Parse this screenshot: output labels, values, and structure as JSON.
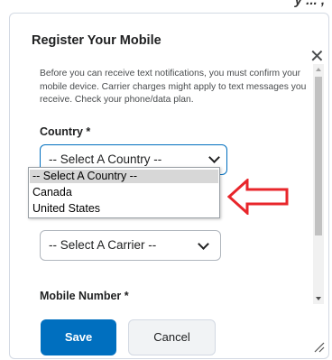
{
  "top_cut_text": "y ... ,",
  "dialog": {
    "title": "Register Your Mobile",
    "close_icon": "close-icon",
    "info_text": "Before you can receive text notifications, you must confirm your mobile device. Carrier charges might apply to text messages you receive. Check your phone/data plan.",
    "country_label": "Country *",
    "country_value": "-- Select A Country --",
    "country_options": [
      "-- Select A Country --",
      "Canada",
      "United States"
    ],
    "country_selected_index": 0,
    "carrier_value": "-- Select A Carrier --",
    "mobile_label": "Mobile Number *",
    "save_label": "Save",
    "cancel_label": "Cancel"
  },
  "annotation": {
    "arrow_color": "#e8262b",
    "arrow_icon": "left-arrow-icon"
  },
  "colors": {
    "primary": "#006fbf",
    "focus_border": "#006fbf"
  }
}
